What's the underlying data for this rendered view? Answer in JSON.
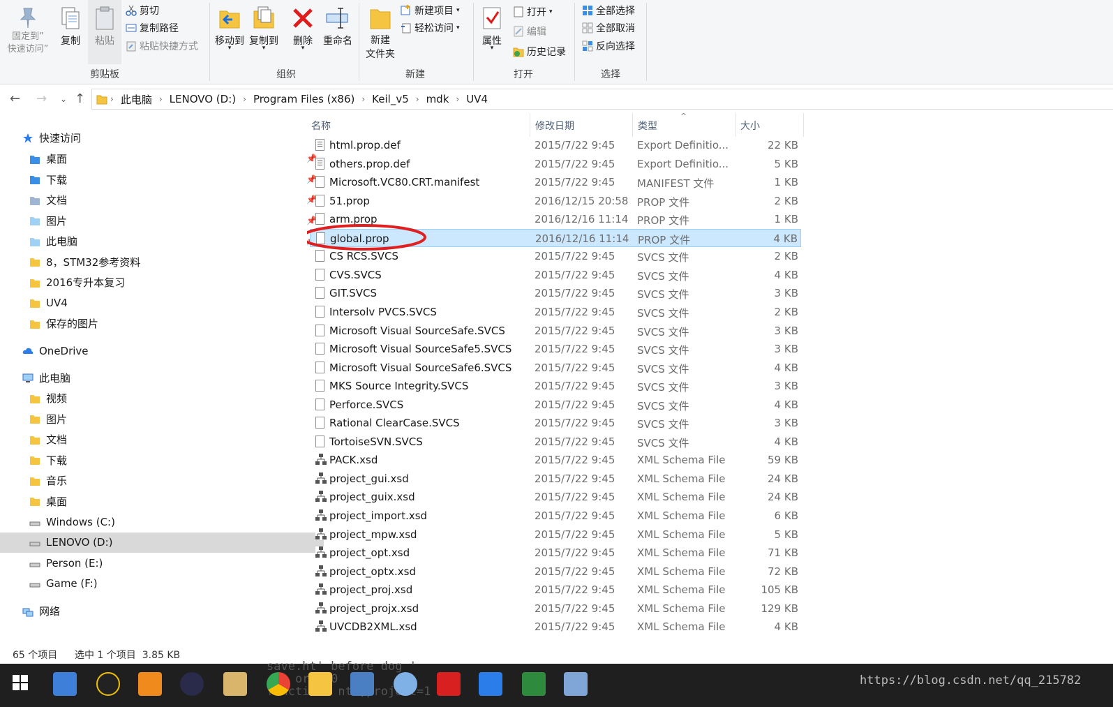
{
  "ribbon": {
    "clipboard": {
      "pin_label": "固定到”\n快速访问”",
      "copy_label": "复制",
      "paste_label": "粘贴",
      "cut_label": "剪切",
      "copy_path_label": "复制路径",
      "paste_shortcut_label": "粘贴快捷方式",
      "group_label": "剪贴板"
    },
    "organize": {
      "move_to_label": "移动到",
      "copy_to_label": "复制到",
      "delete_label": "删除",
      "rename_label": "重命名",
      "group_label": "组织"
    },
    "new": {
      "new_folder_label": "新建\n文件夹",
      "new_item_label": "新建项目",
      "easy_access_label": "轻松访问",
      "group_label": "新建"
    },
    "open": {
      "properties_label": "属性",
      "open_label": "打开",
      "edit_label": "编辑",
      "history_label": "历史记录",
      "group_label": "打开"
    },
    "select": {
      "select_all_label": "全部选择",
      "select_none_label": "全部取消",
      "invert_label": "反向选择",
      "group_label": "选择"
    }
  },
  "address": {
    "crumbs": [
      "此电脑",
      "LENOVO (D:)",
      "Program Files (x86)",
      "Keil_v5",
      "mdk",
      "UV4"
    ]
  },
  "nav": {
    "quick_access": "快速访问",
    "quick_items": [
      "桌面",
      "下载",
      "文档",
      "图片",
      "此电脑",
      "8，STM32参考资料",
      "2016专升本复习",
      "UV4",
      "保存的图片"
    ],
    "onedrive": "OneDrive",
    "this_pc": "此电脑",
    "pc_items": [
      "视频",
      "图片",
      "文档",
      "下载",
      "音乐",
      "桌面",
      "Windows (C:)",
      "LENOVO (D:)",
      "Person (E:)",
      "Game (F:)"
    ],
    "network": "网络"
  },
  "columns": {
    "name": "名称",
    "date": "修改日期",
    "type": "类型",
    "size": "大小"
  },
  "files": [
    {
      "name": "html.prop.def",
      "date": "2015/7/22 9:45",
      "type": "Export Definitio...",
      "size": "22 KB",
      "icon": "txt"
    },
    {
      "name": "others.prop.def",
      "date": "2015/7/22 9:45",
      "type": "Export Definitio...",
      "size": "5 KB",
      "icon": "txt"
    },
    {
      "name": "Microsoft.VC80.CRT.manifest",
      "date": "2015/7/22 9:45",
      "type": "MANIFEST 文件",
      "size": "1 KB",
      "icon": "blank"
    },
    {
      "name": "51.prop",
      "date": "2016/12/15 20:58",
      "type": "PROP 文件",
      "size": "2 KB",
      "icon": "blank"
    },
    {
      "name": "arm.prop",
      "date": "2016/12/16 11:14",
      "type": "PROP 文件",
      "size": "1 KB",
      "icon": "blank"
    },
    {
      "name": "global.prop",
      "date": "2016/12/16 11:14",
      "type": "PROP 文件",
      "size": "4 KB",
      "icon": "blank",
      "selected": true
    },
    {
      "name": "CS RCS.SVCS",
      "date": "2015/7/22 9:45",
      "type": "SVCS 文件",
      "size": "2 KB",
      "icon": "blank"
    },
    {
      "name": "CVS.SVCS",
      "date": "2015/7/22 9:45",
      "type": "SVCS 文件",
      "size": "4 KB",
      "icon": "blank"
    },
    {
      "name": "GIT.SVCS",
      "date": "2015/7/22 9:45",
      "type": "SVCS 文件",
      "size": "3 KB",
      "icon": "blank"
    },
    {
      "name": "Intersolv PVCS.SVCS",
      "date": "2015/7/22 9:45",
      "type": "SVCS 文件",
      "size": "2 KB",
      "icon": "blank"
    },
    {
      "name": "Microsoft Visual SourceSafe.SVCS",
      "date": "2015/7/22 9:45",
      "type": "SVCS 文件",
      "size": "3 KB",
      "icon": "blank"
    },
    {
      "name": "Microsoft Visual SourceSafe5.SVCS",
      "date": "2015/7/22 9:45",
      "type": "SVCS 文件",
      "size": "3 KB",
      "icon": "blank"
    },
    {
      "name": "Microsoft Visual SourceSafe6.SVCS",
      "date": "2015/7/22 9:45",
      "type": "SVCS 文件",
      "size": "4 KB",
      "icon": "blank"
    },
    {
      "name": "MKS Source Integrity.SVCS",
      "date": "2015/7/22 9:45",
      "type": "SVCS 文件",
      "size": "3 KB",
      "icon": "blank"
    },
    {
      "name": "Perforce.SVCS",
      "date": "2015/7/22 9:45",
      "type": "SVCS 文件",
      "size": "4 KB",
      "icon": "blank"
    },
    {
      "name": "Rational ClearCase.SVCS",
      "date": "2015/7/22 9:45",
      "type": "SVCS 文件",
      "size": "3 KB",
      "icon": "blank"
    },
    {
      "name": "TortoiseSVN.SVCS",
      "date": "2015/7/22 9:45",
      "type": "SVCS 文件",
      "size": "4 KB",
      "icon": "blank"
    },
    {
      "name": "PACK.xsd",
      "date": "2015/7/22 9:45",
      "type": "XML Schema File",
      "size": "59 KB",
      "icon": "xsd"
    },
    {
      "name": "project_gui.xsd",
      "date": "2015/7/22 9:45",
      "type": "XML Schema File",
      "size": "24 KB",
      "icon": "xsd"
    },
    {
      "name": "project_guix.xsd",
      "date": "2015/7/22 9:45",
      "type": "XML Schema File",
      "size": "24 KB",
      "icon": "xsd"
    },
    {
      "name": "project_import.xsd",
      "date": "2015/7/22 9:45",
      "type": "XML Schema File",
      "size": "6 KB",
      "icon": "xsd"
    },
    {
      "name": "project_mpw.xsd",
      "date": "2015/7/22 9:45",
      "type": "XML Schema File",
      "size": "5 KB",
      "icon": "xsd"
    },
    {
      "name": "project_opt.xsd",
      "date": "2015/7/22 9:45",
      "type": "XML Schema File",
      "size": "71 KB",
      "icon": "xsd"
    },
    {
      "name": "project_optx.xsd",
      "date": "2015/7/22 9:45",
      "type": "XML Schema File",
      "size": "72 KB",
      "icon": "xsd"
    },
    {
      "name": "project_proj.xsd",
      "date": "2015/7/22 9:45",
      "type": "XML Schema File",
      "size": "105 KB",
      "icon": "xsd"
    },
    {
      "name": "project_projx.xsd",
      "date": "2015/7/22 9:45",
      "type": "XML Schema File",
      "size": "129 KB",
      "icon": "xsd"
    },
    {
      "name": "UVCDB2XML.xsd",
      "date": "2015/7/22 9:45",
      "type": "XML Schema File",
      "size": "4 KB",
      "icon": "xsd"
    }
  ],
  "status": {
    "count": "65 个项目",
    "selection": "选中 1 个项目  3.85 KB"
  },
  "taskbar": {
    "watermark": "https://blog.csdn.net/qq_215782"
  },
  "colors": {
    "selection_bg": "#cce8ff",
    "annotation": "#e02020"
  }
}
